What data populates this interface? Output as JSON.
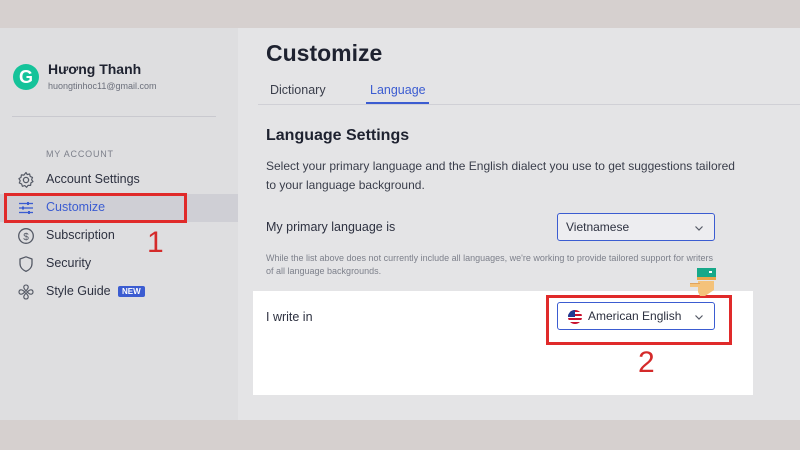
{
  "user": {
    "initial": "G",
    "name": "Hương Thanh",
    "email": "huongtinhoc11@gmail.com"
  },
  "sidebar": {
    "section_label": "MY ACCOUNT",
    "items": [
      {
        "label": "Account Settings",
        "icon": "gear-icon"
      },
      {
        "label": "Customize",
        "icon": "sliders-icon",
        "active": true
      },
      {
        "label": "Subscription",
        "icon": "dollar-icon"
      },
      {
        "label": "Security",
        "icon": "shield-icon"
      },
      {
        "label": "Style Guide",
        "icon": "style-guide-icon",
        "badge": "NEW"
      }
    ]
  },
  "main": {
    "title": "Customize",
    "tabs": [
      {
        "label": "Dictionary"
      },
      {
        "label": "Language",
        "active": true
      }
    ],
    "section_title": "Language Settings",
    "description": "Select your primary language and the English dialect you use to get suggestions tailored to your language background.",
    "primary_language": {
      "label": "My primary language is",
      "value": "Vietnamese"
    },
    "note": "While the list above does not currently include all languages, we're working to provide tailored support for writers of all language backgrounds.",
    "write_in": {
      "label": "I write in",
      "value": "American English",
      "flag": "us-flag-icon"
    }
  },
  "annotations": {
    "step1": "1",
    "step2": "2"
  },
  "colors": {
    "accent": "#3b5cd1",
    "brand": "#15c39a",
    "annotation_red": "#e02a2a"
  }
}
